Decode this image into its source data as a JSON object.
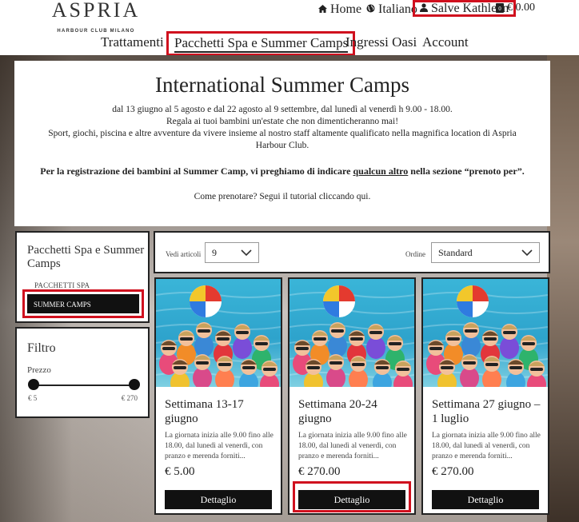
{
  "header": {
    "logo_main": "ASPRIA",
    "logo_sub": "HARBOUR CLUB MILANO",
    "home_label": "Home",
    "lang_label": "Italiano",
    "user_label": "Salve Kathleen",
    "cart_count": "0",
    "cart_total": "€ 0.00",
    "nav": [
      {
        "label": "Trattamenti"
      },
      {
        "label": "Pacchetti Spa e Summer Camps"
      },
      {
        "label": "Ingressi Oasi"
      },
      {
        "label": "Account"
      }
    ]
  },
  "hero": {
    "title": "International Summer Camps",
    "line1": "dal 13 giugno al 5 agosto e dal 22 agosto al 9 settembre, dal lunedì al venerdì h 9.00 - 18.00.",
    "line2": "Regala ai tuoi bambini un'estate che non dimenticheranno mai!",
    "line3": "Sport, giochi, piscina e altre avventure da vivere insieme al nostro staff altamente qualificato nella magnifica location di Aspria Harbour Club.",
    "reg_pre": "Per la registrazione dei bambini al Summer Camp, vi preghiamo di indicare ",
    "reg_link": "qualcun altro",
    "reg_post": " nella sezione “prenoto per”.",
    "tutorial": "Come prenotare? Segui il tutorial cliccando qui."
  },
  "sidebar": {
    "categories_title": "Pacchetti Spa e Summer Camps",
    "cat_spa": "PACCHETTI SPA",
    "cat_summer": "SUMMER CAMPS",
    "filter_title": "Filtro",
    "filter_price_label": "Prezzo",
    "price_min": "€ 5",
    "price_max": "€ 270"
  },
  "toolbar": {
    "items_label": "Vedi articoli",
    "items_value": "9",
    "order_label": "Ordine",
    "order_value": "Standard"
  },
  "products": [
    {
      "title": "Settimana 13-17 giugno",
      "desc": "La giornata inizia alle 9.00 fino alle 18.00, dal lunedì al venerdì, con pranzo e merenda forniti...",
      "price": "€ 5.00",
      "button": "Dettaglio"
    },
    {
      "title": "Settimana 20-24 giugno",
      "desc": "La giornata inizia alle 9.00 fino alle 18.00, dal lunedì al venerdì, con pranzo e merenda forniti...",
      "price": "€ 270.00",
      "button": "Dettaglio"
    },
    {
      "title": "Settimana 27 giugno – 1 luglio",
      "desc": "La giornata inizia alle 9.00 fino alle 18.00, dal lunedì al venerdì, con pranzo e merenda forniti...",
      "price": "€ 270.00",
      "button": "Dettaglio"
    }
  ],
  "colors": {
    "highlight": "#d0101e",
    "button": "#111111"
  }
}
